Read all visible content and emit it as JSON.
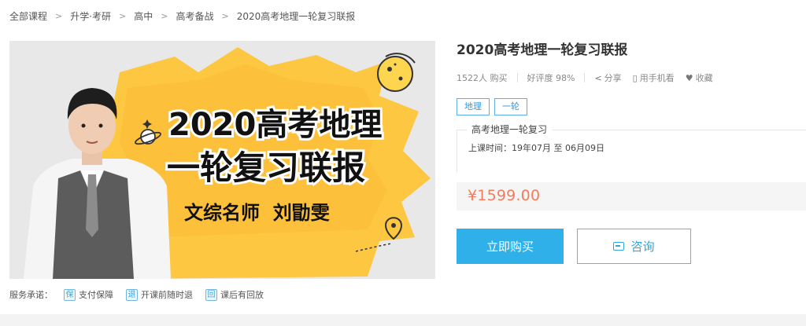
{
  "breadcrumb": {
    "items": [
      "全部课程",
      "升学·考研",
      "高中",
      "高考备战",
      "2020高考地理一轮复习联报"
    ],
    "separator": ">"
  },
  "banner": {
    "headline_line1": "2020高考地理",
    "headline_line2": "一轮复习联报",
    "subline": "文综名师  刘勖雯"
  },
  "services": {
    "label": "服务承诺：",
    "items": [
      {
        "icon": "保",
        "label": "支付保障"
      },
      {
        "icon": "退",
        "label": "开课前随时退"
      },
      {
        "icon": "回",
        "label": "课后有回放"
      }
    ]
  },
  "course": {
    "title": "2020高考地理一轮复习联报",
    "buyers": "1522人 购买",
    "rating": "好评度 98%",
    "share": "分享",
    "mobile": "用手机看",
    "favorite": "收藏",
    "tags": [
      "地理",
      "一轮"
    ],
    "schedule_name": "高考地理一轮复习",
    "schedule_time": "上课时间：19年07月 至 06月09日",
    "price": "¥1599.00",
    "buy_label": "立即购买",
    "consult_label": "咨询"
  },
  "colors": {
    "accent_blue": "#2fb0e8",
    "price_orange": "#f57b5c",
    "banner_yellow": "#fdc741"
  }
}
